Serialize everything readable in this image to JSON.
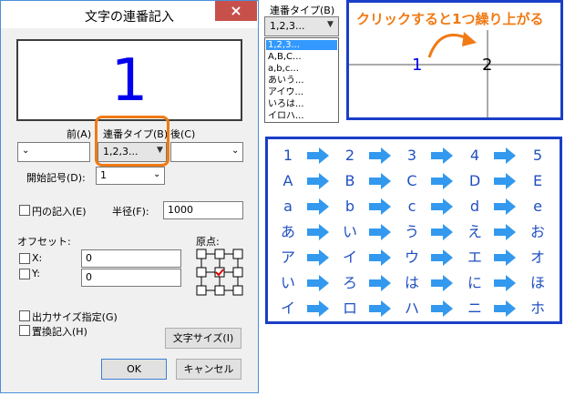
{
  "dialog": {
    "title": "文字の連番記入",
    "close_glyph": "×",
    "preview_value": "1",
    "prefix_label": "前(A)",
    "seq_type_label": "連番タイプ(B)",
    "suffix_label": "後(C)",
    "prefix_value": "",
    "seq_type_value": "1,2,3...",
    "suffix_value": "",
    "start_label": "開始記号(D):",
    "start_value": "1",
    "circle_label": "円の記入(E)",
    "radius_label": "半径(F):",
    "radius_value": "1000",
    "offset_label": "オフセット:",
    "origin_label": "原点:",
    "x_label": "X:",
    "x_value": "0",
    "y_label": "Y:",
    "y_value": "0",
    "output_size_label": "出力サイズ指定(G)",
    "replace_label": "置換記入(H)",
    "char_size_button": "文字サイズ(I)",
    "ok_button": "OK",
    "cancel_button": "キャンセル"
  },
  "dropdown": {
    "label": "連番タイプ(B)",
    "value": "1,2,3...",
    "options": [
      "1,2,3...",
      "A,B,C...",
      "a,b,c...",
      "あいう...",
      "アイウ...",
      "いろは...",
      "イロハ..."
    ],
    "selected_index": 0
  },
  "annotation": {
    "title": "クリックすると1つ繰り上がる",
    "from_value": "1",
    "to_value": "2",
    "accent_color": "#f07a14",
    "border_color": "#1a3ec8"
  },
  "grid": {
    "arrow_color": "#3399ee",
    "rows": [
      [
        "1",
        "2",
        "3",
        "4",
        "5"
      ],
      [
        "A",
        "B",
        "C",
        "D",
        "E"
      ],
      [
        "a",
        "b",
        "c",
        "d",
        "e"
      ],
      [
        "あ",
        "い",
        "う",
        "え",
        "お"
      ],
      [
        "ア",
        "イ",
        "ウ",
        "エ",
        "オ"
      ],
      [
        "い",
        "ろ",
        "は",
        "に",
        "ほ"
      ],
      [
        "イ",
        "ロ",
        "ハ",
        "ニ",
        "ホ"
      ]
    ]
  }
}
